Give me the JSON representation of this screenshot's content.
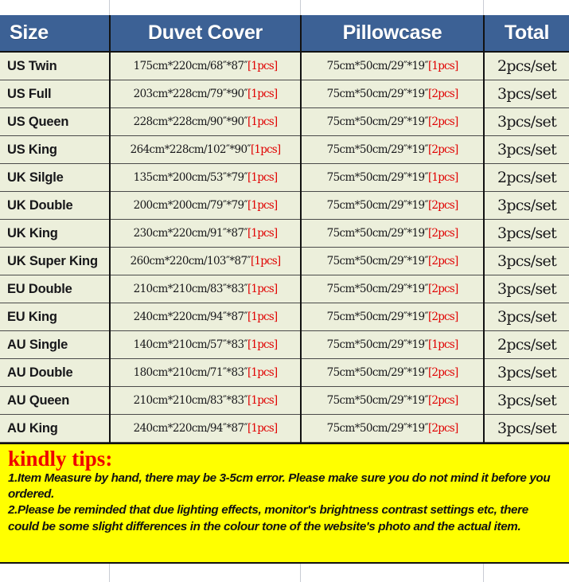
{
  "table": {
    "columns": [
      {
        "key": "size",
        "label": "Size"
      },
      {
        "key": "duvet",
        "label": "Duvet Cover"
      },
      {
        "key": "pillow",
        "label": "Pillowcase"
      },
      {
        "key": "total",
        "label": "Total"
      }
    ],
    "rows": [
      {
        "size": "US Twin",
        "duvet_dim": "175cm*220cm/68″*87″",
        "duvet_qty": "[1pcs]",
        "pillow_dim": "75cm*50cm/29″*19″",
        "pillow_qty": "[1pcs]",
        "total": "2pcs/set"
      },
      {
        "size": "US Full",
        "duvet_dim": "203cm*228cm/79″*90″",
        "duvet_qty": "[1pcs]",
        "pillow_dim": "75cm*50cm/29″*19″",
        "pillow_qty": "[2pcs]",
        "total": "3pcs/set"
      },
      {
        "size": "US Queen",
        "duvet_dim": "228cm*228cm/90″*90″",
        "duvet_qty": "[1pcs]",
        "pillow_dim": "75cm*50cm/29″*19″",
        "pillow_qty": "[2pcs]",
        "total": "3pcs/set"
      },
      {
        "size": "US King",
        "duvet_dim": "264cm*228cm/102″*90″",
        "duvet_qty": "[1pcs]",
        "pillow_dim": "75cm*50cm/29″*19″",
        "pillow_qty": "[2pcs]",
        "total": "3pcs/set"
      },
      {
        "size": "UK Silgle",
        "duvet_dim": "135cm*200cm/53″*79″",
        "duvet_qty": "[1pcs]",
        "pillow_dim": "75cm*50cm/29″*19″",
        "pillow_qty": "[1pcs]",
        "total": "2pcs/set"
      },
      {
        "size": "UK Double",
        "duvet_dim": "200cm*200cm/79″*79″",
        "duvet_qty": "[1pcs]",
        "pillow_dim": "75cm*50cm/29″*19″",
        "pillow_qty": "[2pcs]",
        "total": "3pcs/set"
      },
      {
        "size": "UK King",
        "duvet_dim": "230cm*220cm/91″*87″",
        "duvet_qty": "[1pcs]",
        "pillow_dim": "75cm*50cm/29″*19″",
        "pillow_qty": "[2pcs]",
        "total": "3pcs/set"
      },
      {
        "size": "UK Super King",
        "duvet_dim": "260cm*220cm/103″*87″",
        "duvet_qty": "[1pcs]",
        "pillow_dim": "75cm*50cm/29″*19″",
        "pillow_qty": "[2pcs]",
        "total": "3pcs/set"
      },
      {
        "size": "EU Double",
        "duvet_dim": "210cm*210cm/83″*83″",
        "duvet_qty": "[1pcs]",
        "pillow_dim": "75cm*50cm/29″*19″",
        "pillow_qty": "[2pcs]",
        "total": "3pcs/set"
      },
      {
        "size": "EU King",
        "duvet_dim": "240cm*220cm/94″*87″",
        "duvet_qty": "[1pcs]",
        "pillow_dim": "75cm*50cm/29″*19″",
        "pillow_qty": "[2pcs]",
        "total": "3pcs/set"
      },
      {
        "size": "AU Single",
        "duvet_dim": "140cm*210cm/57″*83″",
        "duvet_qty": "[1pcs]",
        "pillow_dim": "75cm*50cm/29″*19″",
        "pillow_qty": "[1pcs]",
        "total": "2pcs/set"
      },
      {
        "size": "AU Double",
        "duvet_dim": "180cm*210cm/71″*83″",
        "duvet_qty": "[1pcs]",
        "pillow_dim": "75cm*50cm/29″*19″",
        "pillow_qty": "[2pcs]",
        "total": "3pcs/set"
      },
      {
        "size": "AU Queen",
        "duvet_dim": "210cm*210cm/83″*83″",
        "duvet_qty": "[1pcs]",
        "pillow_dim": "75cm*50cm/29″*19″",
        "pillow_qty": "[2pcs]",
        "total": "3pcs/set"
      },
      {
        "size": "AU King",
        "duvet_dim": "240cm*220cm/94″*87″",
        "duvet_qty": "[1pcs]",
        "pillow_dim": "75cm*50cm/29″*19″",
        "pillow_qty": "[2pcs]",
        "total": "3pcs/set"
      }
    ]
  },
  "tips": {
    "title": "kindly tips:",
    "line1": "1.Item Measure by hand, there may be 3-5cm error. Please make sure you do not mind it before you ordered.",
    "line2": "2.Please be reminded that due lighting effects, monitor's brightness contrast settings etc, there could be some slight differences in the colour tone of the website's photo and the actual item."
  },
  "colors": {
    "header_blue": "#3c6195",
    "cell_cream": "#ecefdb",
    "qty_red": "#e00000",
    "tips_yellow": "#ffff00",
    "tips_title_red": "#ee0000",
    "grid_line": "#121212"
  }
}
